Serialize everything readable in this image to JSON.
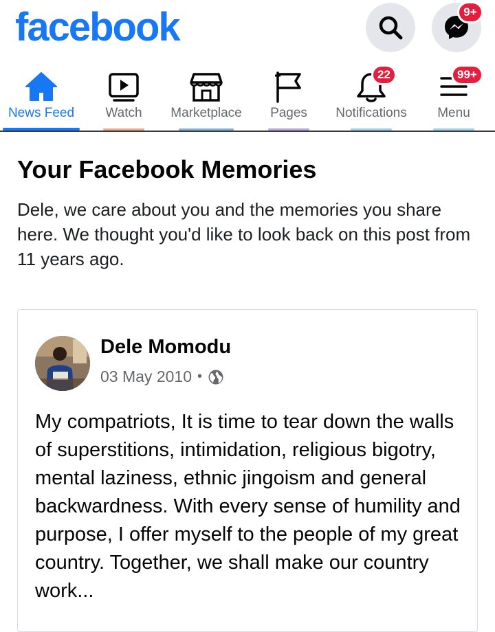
{
  "app": {
    "logo": "facebook"
  },
  "top_actions": {
    "search_icon": "search-icon",
    "messenger_icon": "messenger-icon",
    "messenger_badge": "9+"
  },
  "tabs": [
    {
      "label": "News Feed",
      "icon": "home-icon",
      "active": true,
      "underline": "#1877f2"
    },
    {
      "label": "Watch",
      "icon": "watch-icon",
      "active": false,
      "underline": "#f5a887"
    },
    {
      "label": "Marketplace",
      "icon": "marketplace-icon",
      "active": false,
      "underline": "#7fb6e6"
    },
    {
      "label": "Pages",
      "icon": "flag-icon",
      "active": false,
      "underline": "#b7a3e6"
    },
    {
      "label": "Notifications",
      "icon": "bell-icon",
      "active": false,
      "badge": "22",
      "underline": "#9ad2f0"
    },
    {
      "label": "Menu",
      "icon": "menu-icon",
      "active": false,
      "badge": "99+",
      "underline": "#9ad2f0"
    }
  ],
  "memories": {
    "title": "Your Facebook Memories",
    "description": "Dele, we care about you and the memories you share here. We thought you'd like to look back on this post from 11 years ago."
  },
  "post": {
    "author": "Dele Momodu",
    "date": "03 May 2010",
    "separator": "•",
    "privacy_icon": "globe-icon",
    "text": "My compatriots, It is time to tear down the walls of superstitions, intimidation, religious bigotry, mental laziness, ethnic jingoism and general backwardness. With every sense of humility and purpose, I offer myself to the people of my great country. Together, we shall make our country work..."
  },
  "colors": {
    "brand": "#1877f2",
    "badge": "#e41e3f",
    "muted_text": "#65676b"
  }
}
